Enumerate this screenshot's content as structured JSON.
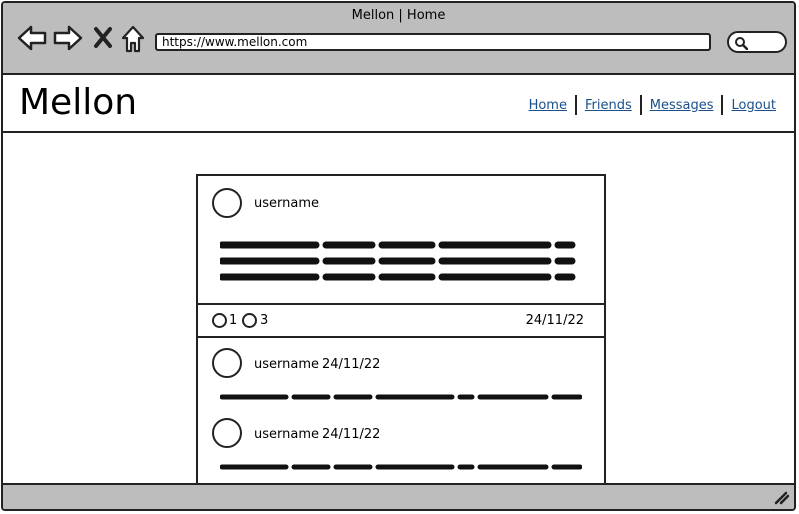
{
  "browser": {
    "title": "Mellon | Home",
    "url": "https://www.mellon.com"
  },
  "header": {
    "logo": "Mellon",
    "nav": [
      "Home",
      "Friends",
      "Messages",
      "Logout"
    ]
  },
  "post": {
    "username": "username",
    "likes": "1",
    "comments": "3",
    "date": "24/11/22"
  },
  "comments": [
    {
      "username": "username",
      "date": "24/11/22"
    },
    {
      "username": "username",
      "date": "24/11/22"
    }
  ],
  "colors": {
    "chrome": "#bdbdbd",
    "link": "#1a4f8a"
  }
}
